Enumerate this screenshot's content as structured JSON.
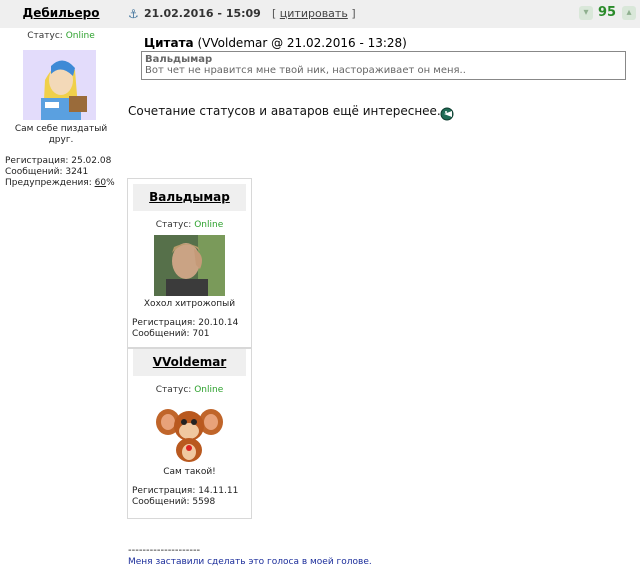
{
  "author": {
    "name": "Дебильеро",
    "status_label": "Статус: ",
    "status_value": "Online",
    "title_line1": "Сам себе пиздатый",
    "title_line2": "друг.",
    "reg_label": "Регистрация: 25.02.08",
    "msgs_label": "Сообщений: 3241",
    "warn_label": "Предупреждения: ",
    "warn_value": "60",
    "warn_suffix": "%"
  },
  "post": {
    "date": "21.02.2016 - 15:09",
    "quote_open": "[ ",
    "quote_link": "цитировать",
    "quote_close": " ]",
    "rating": "95",
    "rate_down_icon": "thumb-down-icon",
    "rate_up_icon": "thumb-up-icon"
  },
  "quote": {
    "label": "Цитата",
    "meta": " (VVoldemar @ 21.02.2016 - 13:28)",
    "author": "Вальдымар",
    "text": "Вот чет не нравится мне твой ник, настораживает он меня.."
  },
  "message": {
    "text": "Сочетание статусов и аватаров ещё интереснее."
  },
  "cards": [
    {
      "name": "Вальдымар",
      "status_label": "Статус: ",
      "status_value": "Online",
      "title": "Хохол хитрожопый",
      "reg": "Регистрация: 20.10.14",
      "msgs": "Сообщений: 701"
    },
    {
      "name": "VVoldemar",
      "status_label": "Статус: ",
      "status_value": "Online",
      "title": "Сам такой!",
      "reg": "Регистрация: 14.11.11",
      "msgs": "Сообщений: 5598"
    }
  ],
  "signature": {
    "separator": "--------------------",
    "text": "Меня заставили сделать это голоса в моей голове."
  },
  "colors": {
    "online": "#2da12d",
    "rating": "#2b8b2b",
    "signature": "#1c2e9b",
    "bar": "#efefef"
  }
}
